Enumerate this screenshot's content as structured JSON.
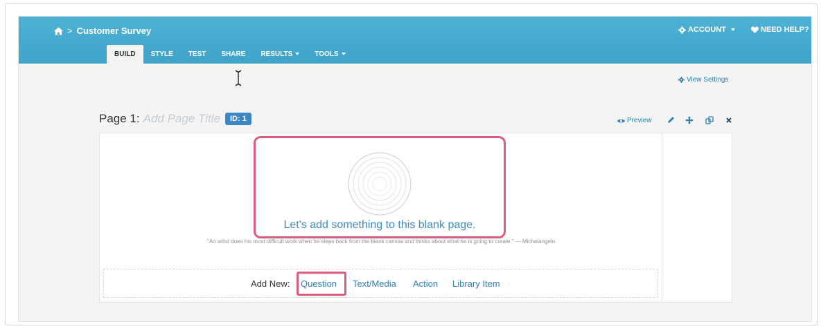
{
  "breadcrumb": {
    "title": "Customer Survey"
  },
  "header": {
    "account_label": "ACCOUNT",
    "help_label": "NEED HELP?"
  },
  "tabs": [
    {
      "label": "BUILD",
      "active": true
    },
    {
      "label": "STYLE"
    },
    {
      "label": "TEST"
    },
    {
      "label": "SHARE"
    },
    {
      "label": "RESULTS"
    },
    {
      "label": "TOOLS"
    }
  ],
  "view_settings": "View Settings",
  "page": {
    "label": "Page 1:",
    "title_placeholder": "Add Page Title",
    "id_badge": "ID: 1",
    "preview_label": "Preview"
  },
  "empty_state": {
    "message": "Let's add something to this blank page.",
    "quote": "\"An artist does his most difficult work when he steps back from the blank canvas and thinks about what he is going to create.\" — Michelangelo"
  },
  "add_new": {
    "label": "Add New:",
    "links": [
      "Question",
      "Text/Media",
      "Action",
      "Library Item"
    ]
  },
  "colors": {
    "header": "#44a8cf",
    "accent": "#3b8ac4",
    "highlight": "#dd5b7c"
  }
}
